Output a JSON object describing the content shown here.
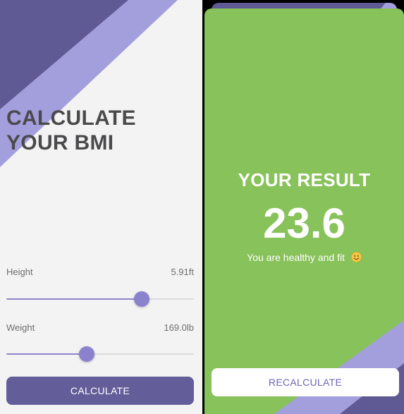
{
  "colors": {
    "left_background": "#f3f3f3",
    "decor_dark": "#5f5a94",
    "decor_light": "#a39fdc",
    "title_text": "#4a4a4c",
    "slider_fill": "#8d85cc",
    "slider_track": "#dcdcde",
    "calculate_button": "#635e99",
    "result_background": "#88c25a",
    "recalculate_text": "#6c64b8"
  },
  "calculator": {
    "title_line1": "CALCULATE",
    "title_line2": "YOUR BMI",
    "height": {
      "label": "Height",
      "value_text": "5.91ft",
      "slider_fraction": 0.72
    },
    "weight": {
      "label": "Weight",
      "value_text": "169.0lb",
      "slider_fraction": 0.43
    },
    "calculate_label": "CALCULATE"
  },
  "result": {
    "heading": "YOUR RESULT",
    "value": "23.6",
    "message": "You are healthy and fit",
    "message_icon": "smiling-face-emoji",
    "recalculate_label": "RECALCULATE"
  }
}
